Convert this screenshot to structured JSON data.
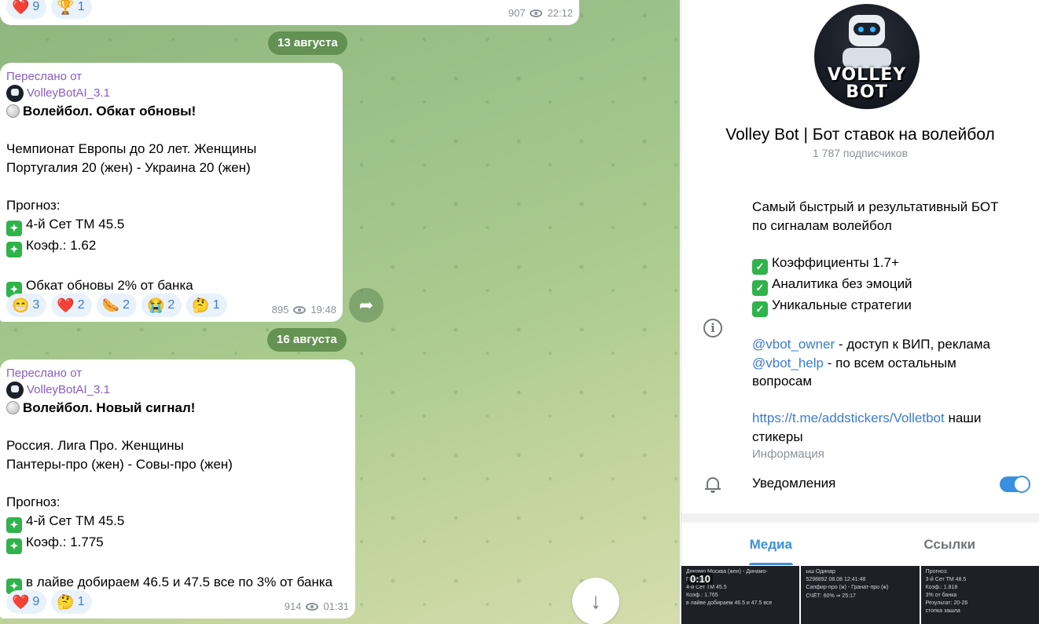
{
  "chat": {
    "top_message": {
      "reactions": [
        {
          "emoji": "❤️",
          "count": "9"
        },
        {
          "emoji": "🏆",
          "count": "1"
        }
      ],
      "views": "907",
      "time": "22:12"
    },
    "date_1": "13 августа",
    "date_2": "16 августа",
    "forward_label": "Переслано от",
    "forward_source": "VolleyBotAI_3.1",
    "message_1": {
      "lines": [
        {
          "icon": "volleyball",
          "text": "Волейбол. Обкат обновы!"
        },
        {
          "icon": "",
          "text": ""
        },
        {
          "icon": "",
          "text": "Чемпионат Европы до 20 лет. Женщины"
        },
        {
          "icon": "",
          "text": "Португалия 20 (жен) - Украина 20 (жен)"
        },
        {
          "icon": "",
          "text": ""
        },
        {
          "icon": "",
          "text": "Прогноз:"
        },
        {
          "icon": "sparkle",
          "text": "4-й Сет ТМ 45.5"
        },
        {
          "icon": "sparkle",
          "text": "Коэф.: 1.62"
        },
        {
          "icon": "",
          "text": ""
        },
        {
          "icon": "sparkle",
          "text": "Обкат обновы 2% от банка"
        }
      ],
      "reactions": [
        {
          "emoji": "😁",
          "count": "3"
        },
        {
          "emoji": "❤️",
          "count": "2"
        },
        {
          "emoji": "🌭",
          "count": "2"
        },
        {
          "emoji": "😭",
          "count": "2"
        },
        {
          "emoji": "🤔",
          "count": "1"
        }
      ],
      "views": "895",
      "time": "19:48"
    },
    "message_2": {
      "lines": [
        {
          "icon": "volleyball",
          "text": "Волейбол. Новый сигнал!"
        },
        {
          "icon": "",
          "text": ""
        },
        {
          "icon": "",
          "text": "Россия. Лига Про. Женщины"
        },
        {
          "icon": "",
          "text": "Пантеры-про (жен) - Совы-про (жен)"
        },
        {
          "icon": "",
          "text": ""
        },
        {
          "icon": "",
          "text": "Прогноз:"
        },
        {
          "icon": "sparkle",
          "text": "4-й Сет ТМ 45.5"
        },
        {
          "icon": "sparkle",
          "text": "Коэф.: 1.775"
        },
        {
          "icon": "",
          "text": ""
        },
        {
          "icon": "sparkle",
          "text": "в лайве добираем 46.5 и 47.5 все по 3% от банка"
        }
      ],
      "reactions": [
        {
          "emoji": "❤️",
          "count": "9"
        },
        {
          "emoji": "🤔",
          "count": "1"
        }
      ],
      "views": "914",
      "time": "01:31"
    }
  },
  "panel": {
    "avatar_text_1": "VOLLEY",
    "avatar_text_2": "BOT",
    "title": "Volley Bot | Бот ставок на волейбол",
    "subscribers": "1 787 подписчиков",
    "description": {
      "line1": "Самый быстрый и результативный БОТ",
      "line2": "по сигналам волейбол",
      "check1": "Коэффициенты 1.7+",
      "check2": "Аналитика без эмоций",
      "check3": "Уникальные стратегии",
      "owner_link": "@vbot_owner",
      "owner_text": " - доступ к ВИП, реклама",
      "help_link": "@vbot_help",
      "help_text": " - по всем остальным",
      "help_text2": "вопросам",
      "stickers_link": "https://t.me/addstickers/Volletbot",
      "stickers_text": " наши",
      "stickers_text2": "стикеры",
      "caption": "Информация"
    },
    "notifications_label": "Уведомления",
    "notifications_on": true,
    "tabs": [
      "Медиа",
      "Ссылки"
    ],
    "media_thumbs": [
      {
        "duration": "0:10",
        "lines": [
          "Динамо Москва (жен) - Динамо-",
          "Прогноз:",
          "4-й Сет ТМ 45.5",
          "Коэф.: 1.765",
          "в лайве добираем 46.5 и 47.5 все"
        ]
      },
      {
        "duration": "",
        "lines": [
          "ыш Одинар",
          "5298892  08.08  12:41:48",
          "Сапфир-про (ж) - Гранат-про (ж)",
          "СЧЁТ: 60%  ⇒ 25:17"
        ]
      },
      {
        "duration": "",
        "lines": [
          "Прогноз:",
          "3-й Сет ТМ 48.5",
          "Коэф.: 1.818",
          "3% от банка",
          "Результат: 20-26",
          "стопка зашла"
        ]
      }
    ]
  }
}
